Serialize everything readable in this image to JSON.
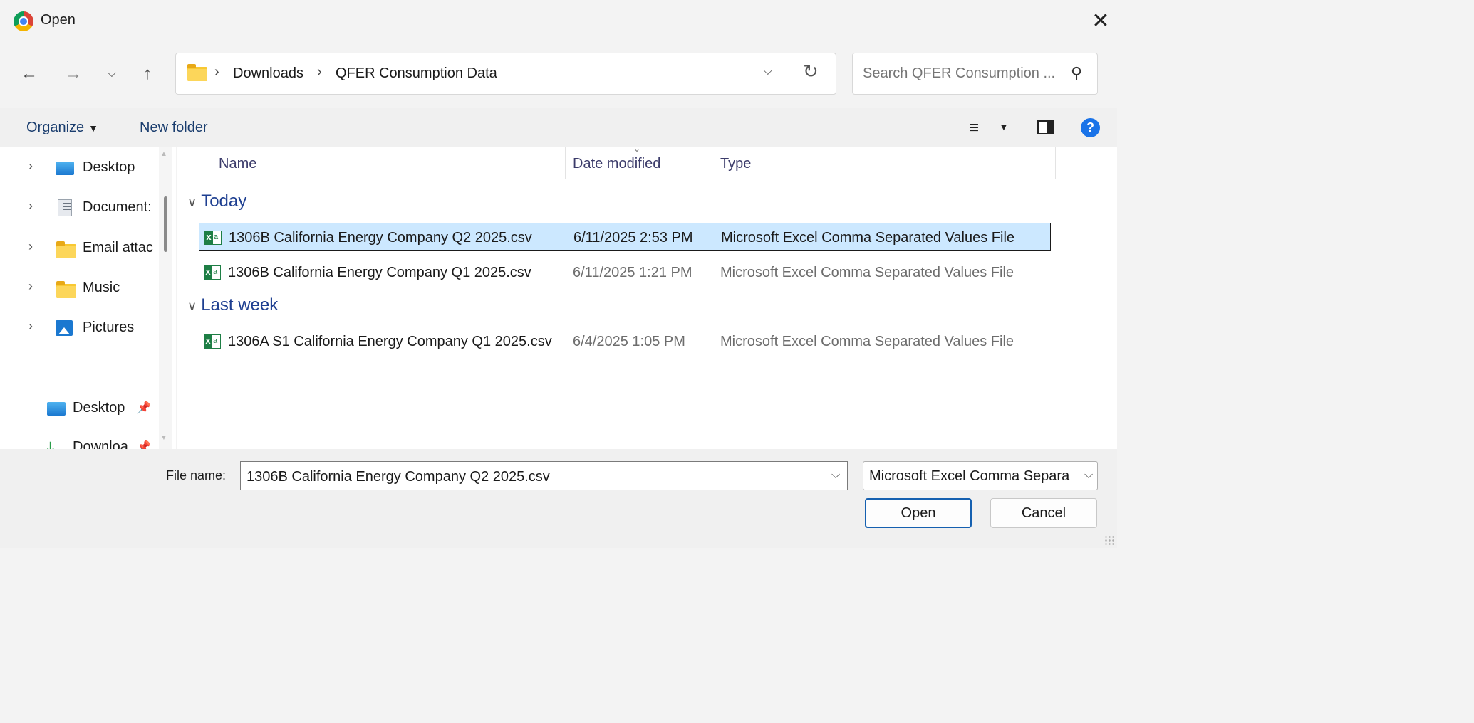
{
  "window": {
    "title": "Open"
  },
  "breadcrumb": [
    "Downloads",
    "QFER Consumption Data"
  ],
  "search": {
    "placeholder": "Search QFER Consumption ..."
  },
  "toolbar": {
    "organize_label": "Organize",
    "new_folder_label": "New folder"
  },
  "nav": {
    "items": [
      {
        "label": "Desktop",
        "icon": "desktop-icon"
      },
      {
        "label": "Document:",
        "icon": "documents-icon"
      },
      {
        "label": "Email attac",
        "icon": "folder-icon"
      },
      {
        "label": "Music",
        "icon": "folder-icon"
      },
      {
        "label": "Pictures",
        "icon": "pictures-icon"
      }
    ],
    "pinned": [
      {
        "label": "Desktop",
        "icon": "desktop-icon"
      },
      {
        "label": "Downloa",
        "icon": "download-icon"
      }
    ]
  },
  "columns": {
    "name": "Name",
    "date": "Date modified",
    "type": "Type"
  },
  "groups": [
    {
      "label": "Today",
      "files": [
        {
          "name": "1306B California Energy Company Q2 2025.csv",
          "date": "6/11/2025 2:53 PM",
          "type": "Microsoft Excel Comma Separated Values File",
          "selected": true
        },
        {
          "name": "1306B California Energy Company Q1 2025.csv",
          "date": "6/11/2025 1:21 PM",
          "type": "Microsoft Excel Comma Separated Values File",
          "selected": false
        }
      ]
    },
    {
      "label": "Last week",
      "files": [
        {
          "name": "1306A S1 California Energy Company Q1 2025.csv",
          "date": "6/4/2025 1:05 PM",
          "type": "Microsoft Excel Comma Separated Values File",
          "selected": false
        }
      ]
    }
  ],
  "bottom": {
    "file_name_label": "File name:",
    "file_name_value": "1306B California Energy Company Q2 2025.csv",
    "file_type_value": "Microsoft Excel Comma Separa",
    "open_label": "Open",
    "cancel_label": "Cancel"
  },
  "colors": {
    "selection": "#cce8ff",
    "accent": "#1560b0",
    "group_header": "#1e3f91"
  }
}
